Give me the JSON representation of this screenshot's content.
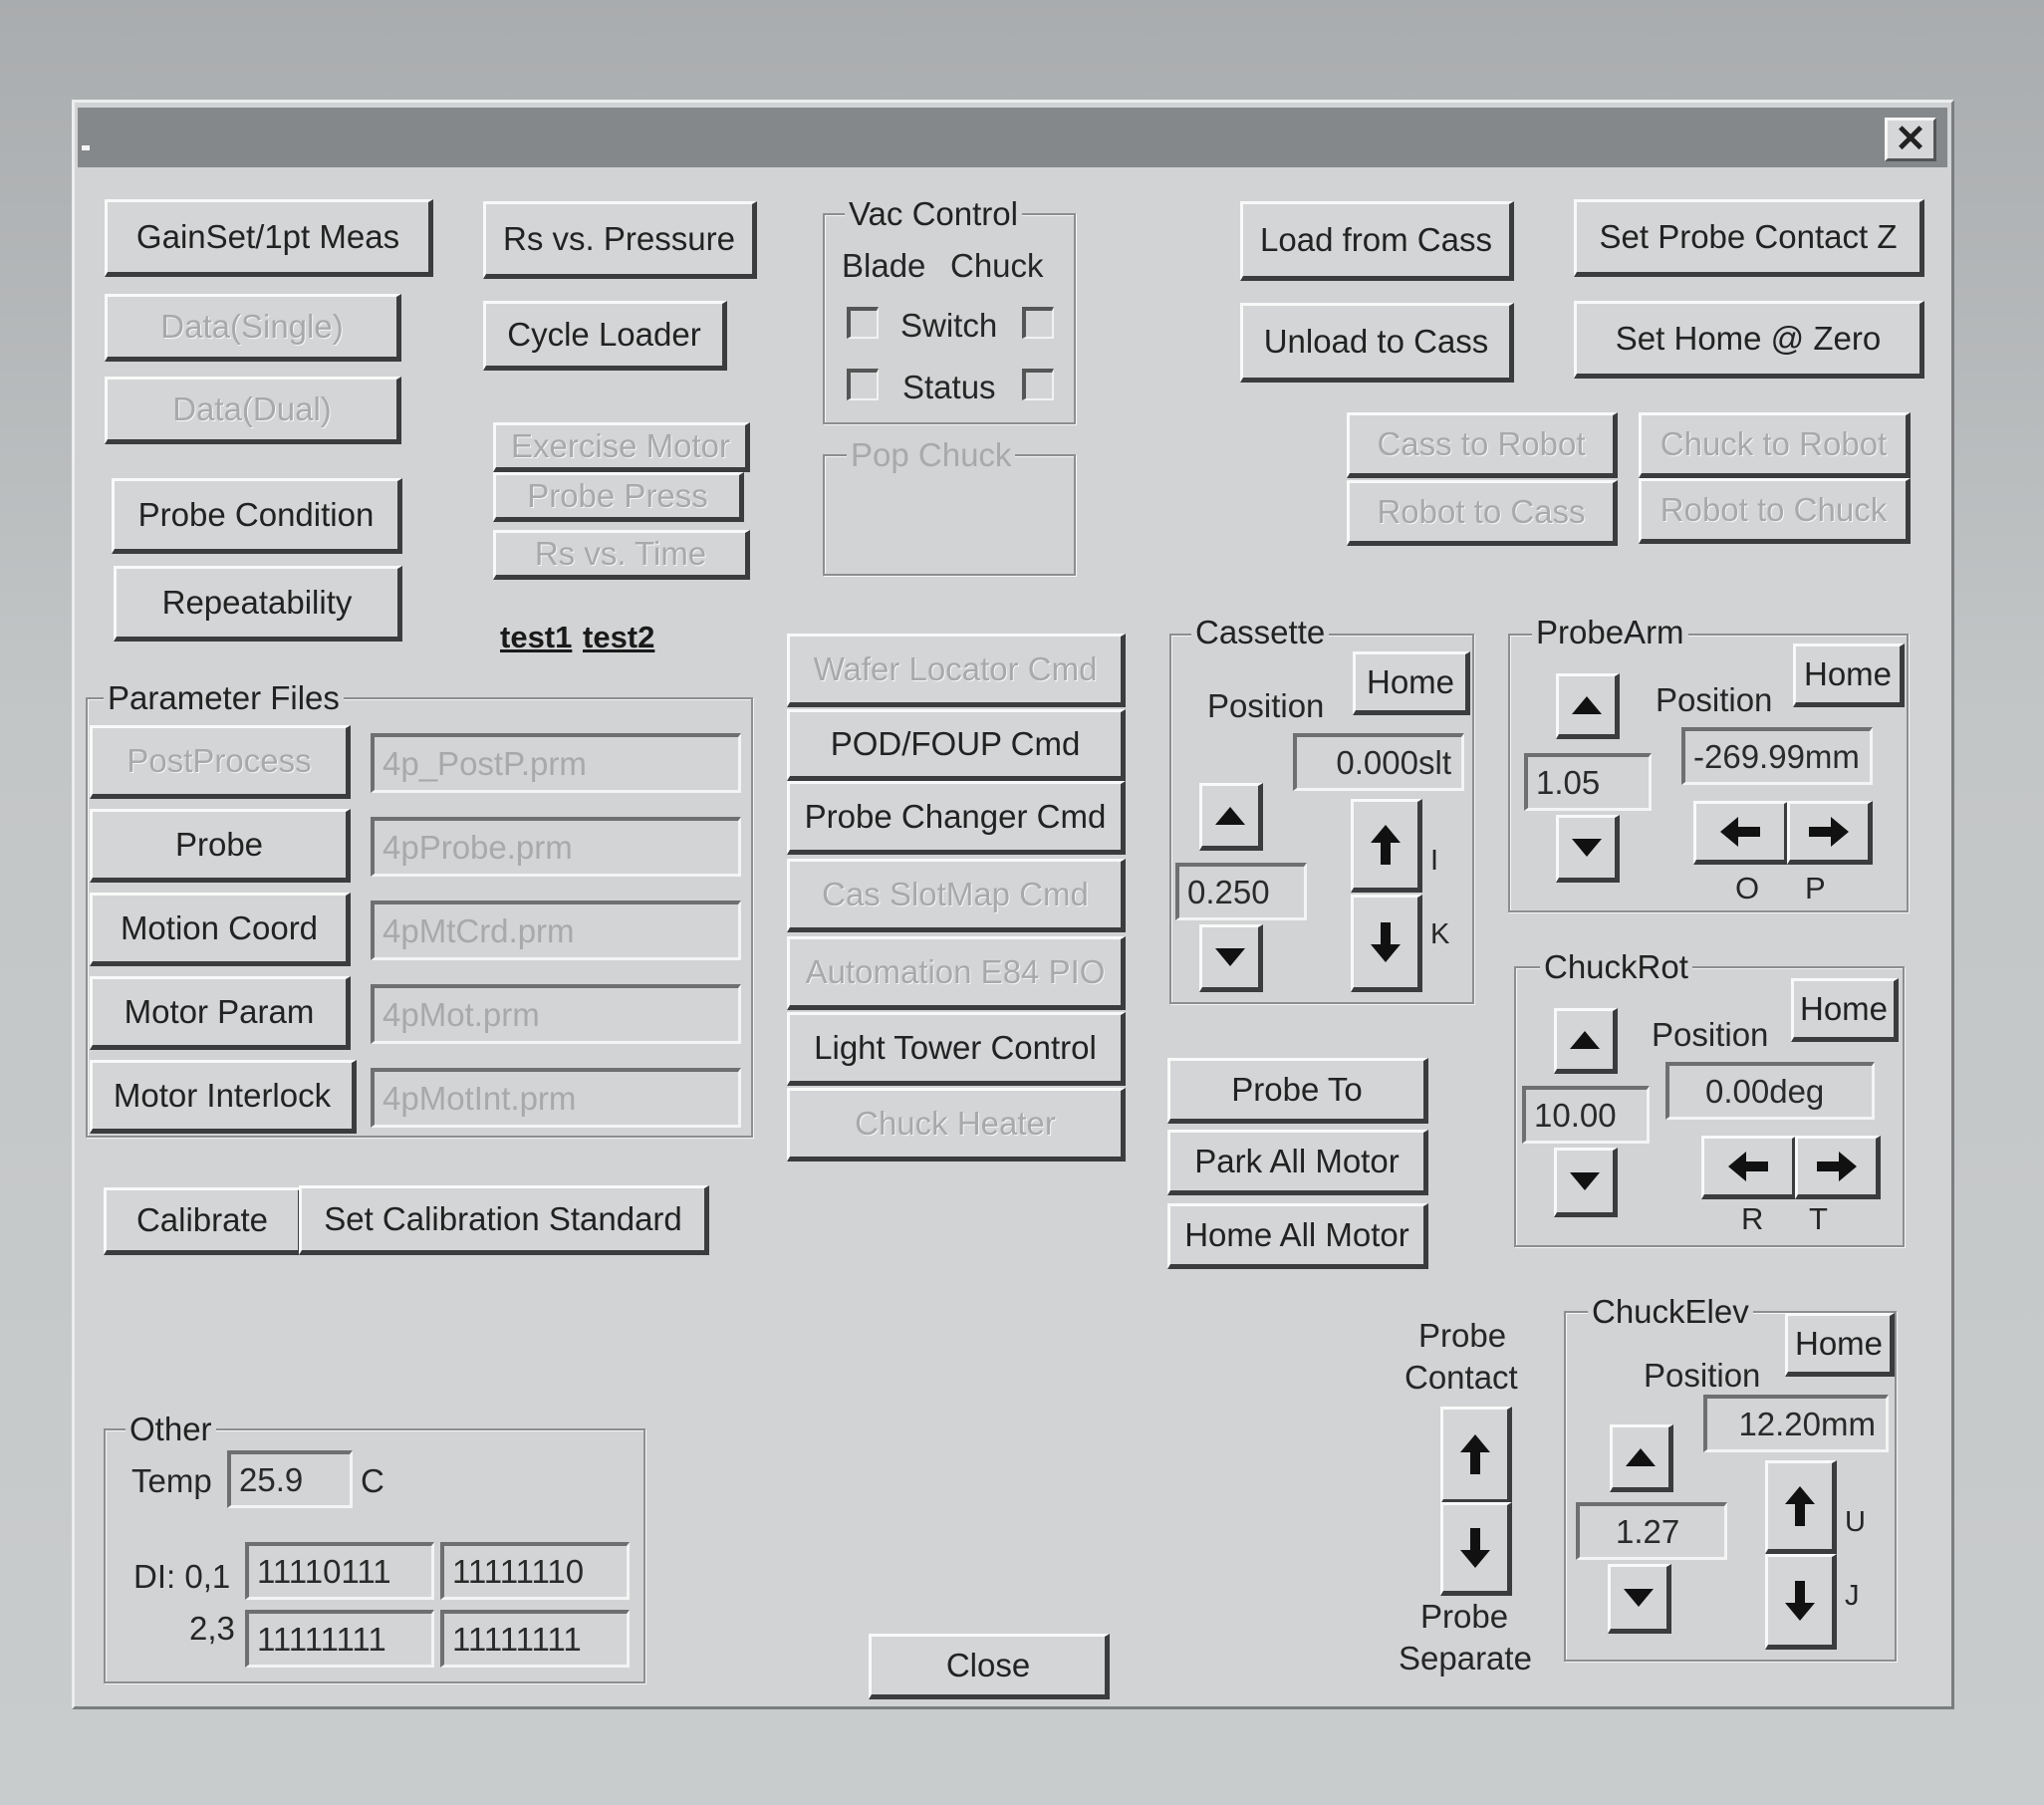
{
  "window": {
    "title": ".",
    "close_glyph": "✕"
  },
  "left_buttons": {
    "gainset": "GainSet/1pt Meas",
    "data_single": "Data(Single)",
    "data_dual": "Data(Dual)",
    "probe_condition": "Probe Condition",
    "repeatability": "Repeatability"
  },
  "mid_buttons": {
    "rs_vs_pressure": "Rs vs. Pressure",
    "cycle_loader": "Cycle Loader",
    "exercise_motor": "Exercise Motor",
    "probe_press": "Probe Press",
    "rs_vs_time": "Rs vs. Time",
    "test1": "test1",
    "test2": "test2"
  },
  "vac_control": {
    "legend": "Vac Control",
    "col_blade": "Blade",
    "col_chuck": "Chuck",
    "switch_label": "Switch",
    "status_label": "Status"
  },
  "pop_chuck": {
    "legend": "Pop Chuck"
  },
  "right_buttons": {
    "load_from_cass": "Load from Cass",
    "unload_to_cass": "Unload to Cass",
    "set_probe_contact_z": "Set Probe Contact Z",
    "set_home_zero": "Set Home @ Zero",
    "cass_to_robot": "Cass to Robot",
    "chuck_to_robot": "Chuck to Robot",
    "robot_to_cass": "Robot to Cass",
    "robot_to_chuck": "Robot to Chuck"
  },
  "parameter_files": {
    "legend": "Parameter Files",
    "rows": [
      {
        "button": "PostProcess",
        "file": "4p_PostP.prm"
      },
      {
        "button": "Probe",
        "file": "4pProbe.prm"
      },
      {
        "button": "Motion Coord",
        "file": "4pMtCrd.prm"
      },
      {
        "button": "Motor Param",
        "file": "4pMot.prm"
      },
      {
        "button": "Motor Interlock",
        "file": "4pMotInt.prm"
      }
    ]
  },
  "cmd_buttons": {
    "wafer_locator": "Wafer Locator Cmd",
    "pod_foup": "POD/FOUP Cmd",
    "probe_changer": "Probe Changer Cmd",
    "cas_slotmap": "Cas SlotMap Cmd",
    "automation_e84": "Automation E84 PIO",
    "light_tower": "Light Tower Control",
    "chuck_heater": "Chuck Heater"
  },
  "calibration": {
    "calibrate": "Calibrate",
    "set_standard": "Set Calibration Standard"
  },
  "cassette": {
    "legend": "Cassette",
    "position_label": "Position",
    "home": "Home",
    "position_value": "0.000slt",
    "step_value": "0.250",
    "up_key": "I",
    "down_key": "K"
  },
  "probe_arm": {
    "legend": "ProbeArm",
    "position_label": "Position",
    "home": "Home",
    "step_value": "1.05",
    "position_value": "-269.99mm",
    "left_key": "O",
    "right_key": "P"
  },
  "chuck_rot": {
    "legend": "ChuckRot",
    "position_label": "Position",
    "home": "Home",
    "step_value": "10.00",
    "position_value": "0.00deg",
    "left_key": "R",
    "right_key": "T"
  },
  "motor_buttons": {
    "probe_to": "Probe To",
    "park_all": "Park All Motor",
    "home_all": "Home All Motor"
  },
  "probe_contact": {
    "top_label_1": "Probe",
    "top_label_2": "Contact",
    "bottom_label_1": "Probe",
    "bottom_label_2": "Separate"
  },
  "chuck_elev": {
    "legend": "ChuckElev",
    "position_label": "Position",
    "home": "Home",
    "position_value": "12.20mm",
    "step_value": "1.27",
    "up_key": "U",
    "down_key": "J"
  },
  "other": {
    "legend": "Other",
    "temp_label": "Temp",
    "temp_value": "25.9",
    "temp_unit": "C",
    "di01_label": "DI: 0,1",
    "di23_label": "2,3",
    "di0": "11110111",
    "di1": "11111110",
    "di2": "11111111",
    "di3": "11111111"
  },
  "close_button": "Close"
}
